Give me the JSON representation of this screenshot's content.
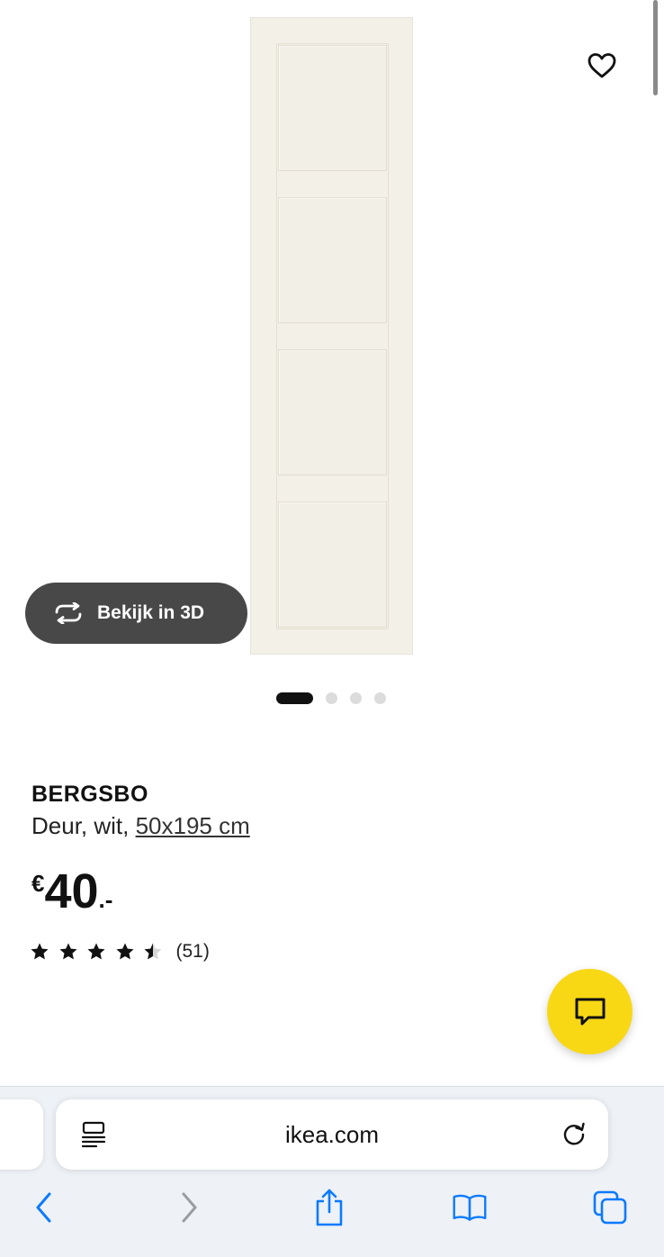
{
  "product": {
    "name": "BERGSBO",
    "description_prefix": "Deur, wit, ",
    "size_link": "50x195 cm",
    "price": {
      "currency": "€",
      "value": "40",
      "suffix": ".-"
    },
    "rating": {
      "value": 4.5,
      "max": 5,
      "count_label": "(51)"
    }
  },
  "gallery": {
    "view3d_label": "Bekijk in 3D",
    "image_count": 4,
    "active_index": 0
  },
  "browser": {
    "url": "ikea.com"
  },
  "icons": {
    "favorite": "heart-outline-icon",
    "view3d": "rotate-arrows-icon",
    "chat": "chat-bubble-icon",
    "reader": "reader-mode-icon",
    "reload": "reload-icon",
    "back": "chevron-left-icon",
    "forward": "chevron-right-icon",
    "share": "share-icon",
    "bookmarks": "open-book-icon",
    "tabs": "tabs-icon"
  },
  "colors": {
    "chat_button": "#F8D814",
    "view3d_button": "#484848",
    "safari_blue": "#0A7AFF"
  }
}
